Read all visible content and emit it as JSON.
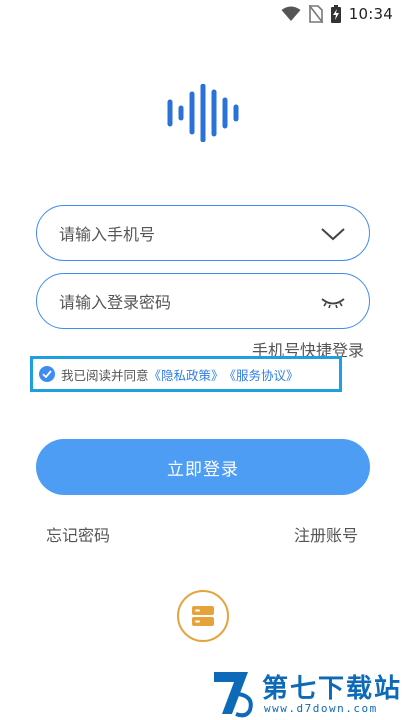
{
  "status_bar": {
    "time": "10:34",
    "icons": [
      "wifi-icon",
      "no-sim-icon",
      "battery-charging-icon"
    ]
  },
  "login": {
    "phone_placeholder": "请输入手机号",
    "password_placeholder": "请输入登录密码",
    "quick_login": "手机号快捷登录",
    "agreement": {
      "prefix": "我已阅读并同意",
      "privacy": "《隐私政策》",
      "service": "《服务协议》",
      "checked": true
    },
    "submit": "立即登录",
    "forgot": "忘记密码",
    "register": "注册账号"
  },
  "watermark": {
    "title": "第七下载站",
    "url": "www.d7down.com"
  },
  "colors": {
    "accent": "#4d9df5",
    "border": "#3f8cf0",
    "highlight": "#1ea0e0",
    "server": "#e7a33b",
    "watermark": "#0d6ab8"
  }
}
